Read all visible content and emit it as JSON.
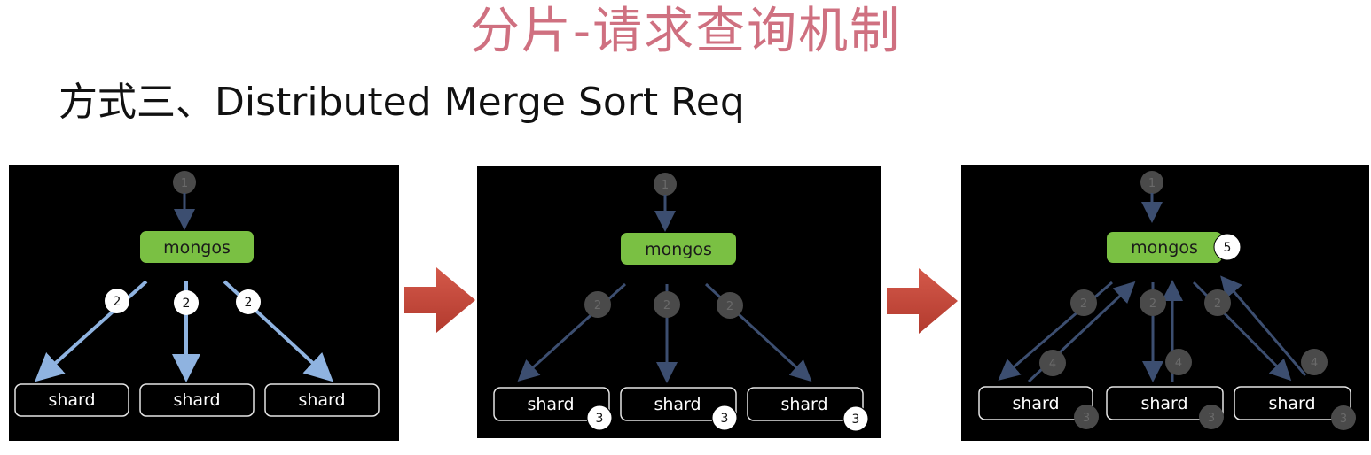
{
  "title": "分片-请求查询机制",
  "subtitle": "方式三、Distributed Merge Sort Req",
  "colors": {
    "title": "#cf7080",
    "panel_bg": "#000000",
    "mongos_fill": "#7ac043",
    "shard_border": "#e6e6e6",
    "arrow_bright": "#8fb3e0",
    "arrow_dim": "#3c4e70",
    "step_arrow": "#c8483a",
    "dim_badge": "#4a4a4a"
  },
  "panels": [
    {
      "mongos": "mongos",
      "shards": [
        "shard",
        "shard",
        "shard"
      ],
      "badges": {
        "step1": "1",
        "step2": "2",
        "step3": "",
        "step4": "",
        "step5": ""
      }
    },
    {
      "mongos": "mongos",
      "shards": [
        "shard",
        "shard",
        "shard"
      ],
      "badges": {
        "step1": "1",
        "step2": "2",
        "step3": "3",
        "step4": "",
        "step5": ""
      }
    },
    {
      "mongos": "mongos",
      "shards": [
        "shard",
        "shard",
        "shard"
      ],
      "badges": {
        "step1": "1",
        "step2": "2",
        "step3": "3",
        "step4": "4",
        "step5": "5"
      }
    }
  ]
}
